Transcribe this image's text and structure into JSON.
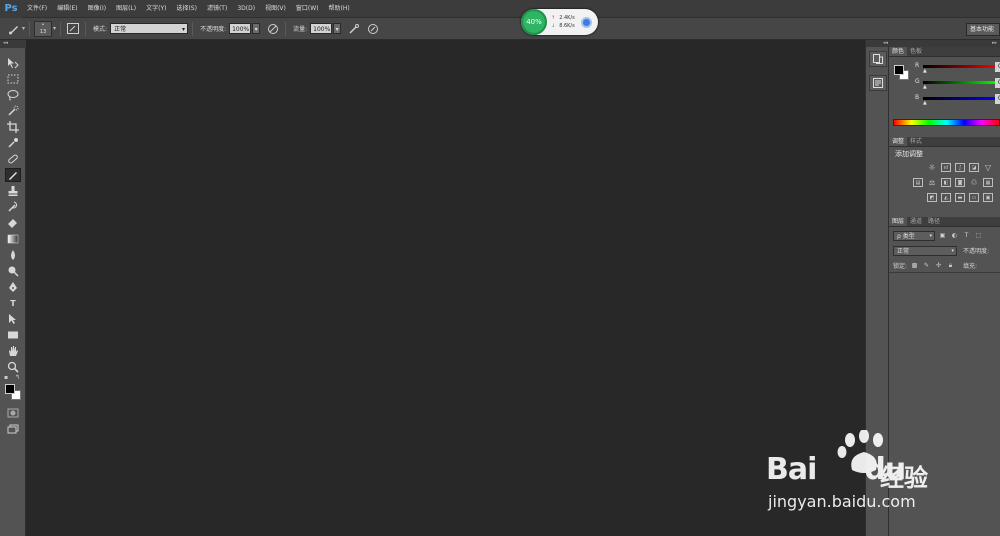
{
  "app": {
    "logo": "Ps"
  },
  "menu": {
    "items": [
      "文件(F)",
      "编辑(E)",
      "图像(I)",
      "图层(L)",
      "文字(Y)",
      "选择(S)",
      "滤镜(T)",
      "3D(D)",
      "视图(V)",
      "窗口(W)",
      "帮助(H)"
    ]
  },
  "options": {
    "brush_size": "13",
    "mode_label": "模式:",
    "mode_value": "正常",
    "opacity_label": "不透明度:",
    "opacity_value": "100%",
    "flow_label": "流量:",
    "flow_value": "100%",
    "workspace": "基本功能"
  },
  "speed_widget": {
    "percent": "40%",
    "upload": "2.4K/s",
    "download": "8.6K/s",
    "accent": "#2fb463"
  },
  "color_panel": {
    "tabs": [
      "颜色",
      "色板"
    ],
    "sliders": [
      {
        "label": "R",
        "value": "0",
        "gradient": "linear-gradient(to right,#000,#ff0000)"
      },
      {
        "label": "G",
        "value": "0",
        "gradient": "linear-gradient(to right,#000,#00ff00)"
      },
      {
        "label": "B",
        "value": "0",
        "gradient": "linear-gradient(to right,#000,#0000ff)"
      }
    ],
    "foreground": "#000000",
    "background": "#ffffff"
  },
  "adjust_panel": {
    "tabs": [
      "调整",
      "样式"
    ],
    "title": "添加调整"
  },
  "layers_panel": {
    "tabs": [
      "图层",
      "通道",
      "路径"
    ],
    "filter_label": "ρ 类型",
    "blend_mode": "正常",
    "opacity_label": "不透明度:",
    "lock_label": "锁定:",
    "fill_label": "填充:"
  },
  "watermark": {
    "brand_a": "Bai",
    "brand_b": "du",
    "brand_cn": "经验",
    "url": "jingyan.baidu.com"
  }
}
